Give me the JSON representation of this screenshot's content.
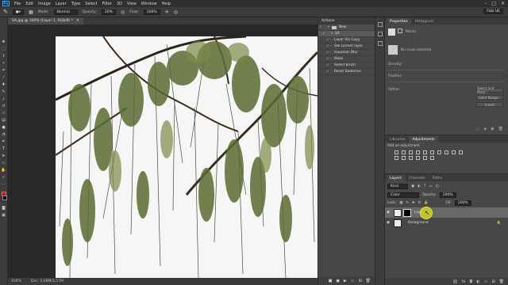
{
  "app": {
    "logo": "Ps",
    "menus": [
      "File",
      "Edit",
      "Image",
      "Layer",
      "Type",
      "Select",
      "Filter",
      "3D",
      "View",
      "Window",
      "Help"
    ]
  },
  "options": {
    "mode_label": "Mode:",
    "mode_value": "Normal",
    "opacity_label": "Opacity:",
    "opacity_value": "20%",
    "flow_label": "Flow:",
    "flow_value": "100%",
    "workspace": "Fabi UE"
  },
  "document": {
    "tab_title": "SA.jpg @ 100% (Layer 1, RGB/8) *",
    "status": "100%",
    "doc_size": "Doc: 2,68M/3,57M"
  },
  "actions": {
    "title": "Actions",
    "items": [
      {
        "label": "New",
        "level": 0,
        "type": "folder"
      },
      {
        "label": "1A",
        "level": 1,
        "type": "action"
      },
      {
        "label": "Layer Via Copy",
        "level": 2,
        "type": "step"
      },
      {
        "label": "Set current layer",
        "level": 2,
        "type": "step"
      },
      {
        "label": "Gaussian Blur",
        "level": 2,
        "type": "step"
      },
      {
        "label": "Make",
        "level": 2,
        "type": "step"
      },
      {
        "label": "Select brush",
        "level": 2,
        "type": "step"
      },
      {
        "label": "Reset Swatches",
        "level": 2,
        "type": "step"
      }
    ]
  },
  "properties": {
    "tabs": [
      "Properties",
      "Histogram"
    ],
    "section": "Masks",
    "no_mask": "No mask selected",
    "density_label": "Density:",
    "feather_label": "Feather:",
    "refine_label": "Refine:",
    "buttons": [
      "Select and Mask...",
      "Color Range...",
      "Invert"
    ]
  },
  "adjustments": {
    "tabs": [
      "Libraries",
      "Adjustments"
    ],
    "title": "Add an adjustment"
  },
  "layers": {
    "tabs": [
      "Layers",
      "Channels",
      "Paths"
    ],
    "filter": "Kind",
    "blend_mode": "Color",
    "opacity_label": "Opacity:",
    "opacity_value": "100%",
    "lock_label": "Lock:",
    "fill_label": "Fill:",
    "fill_value": "100%",
    "rows": [
      {
        "name": "Layer 1"
      },
      {
        "name": "Background"
      }
    ]
  }
}
